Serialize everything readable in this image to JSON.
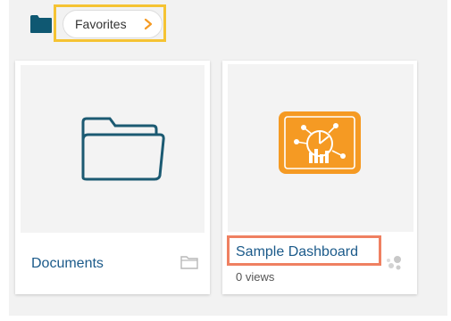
{
  "breadcrumb": {
    "root_icon": "folder-icon",
    "current_label": "Favorites",
    "chevron_icon": "chevron-right-icon"
  },
  "cards": [
    {
      "title": "Documents",
      "type_icon": "folder-outline-icon",
      "thumbnail_icon": "folder-icon"
    },
    {
      "title": "Sample Dashboard",
      "views": "0 views",
      "type_icon": "dashboard-type-icon",
      "thumbnail_icon": "dashboard-chart-icon"
    }
  ],
  "colors": {
    "breadcrumb_highlight": "#f5c333",
    "dashboard_title_highlight": "#ef8061",
    "folder_icon": "#1b5a72",
    "dashboard_icon": "#f59a23",
    "title_text": "#1b5a8a"
  }
}
